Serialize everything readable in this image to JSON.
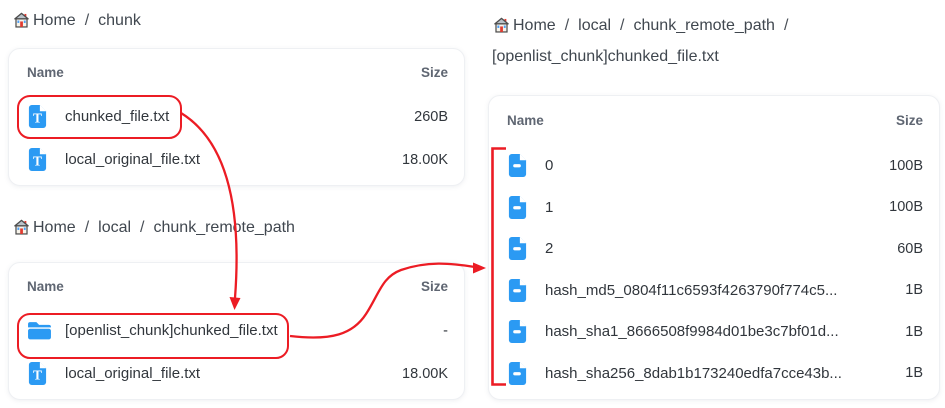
{
  "ui": {
    "breadcrumb_separator": "/"
  },
  "colors": {
    "annotation_red": "#ec1c24",
    "icon_blue": "#2b9af3"
  },
  "panels": [
    {
      "name": "chunk-folder-view",
      "breadcrumb": {
        "items": [
          "Home",
          "chunk"
        ]
      },
      "table": {
        "headers": [
          "Name",
          "Size"
        ],
        "rows": [
          {
            "name": "chunked_file.txt",
            "size": "260B",
            "icon": "text-file",
            "highlighted": true
          },
          {
            "name": "local_original_file.txt",
            "size": "18.00K",
            "icon": "text-file",
            "highlighted": false
          }
        ]
      }
    },
    {
      "name": "chunk-remote-path-view",
      "breadcrumb": {
        "items": [
          "Home",
          "local",
          "chunk_remote_path"
        ]
      },
      "table": {
        "headers": [
          "Name",
          "Size"
        ],
        "rows": [
          {
            "name": "[openlist_chunk]chunked_file.txt",
            "size": "-",
            "icon": "folder",
            "highlighted": true
          },
          {
            "name": "local_original_file.txt",
            "size": "18.00K",
            "icon": "text-file",
            "highlighted": false
          }
        ]
      }
    },
    {
      "name": "chunked-file-contents-view",
      "breadcrumb": {
        "items": [
          "Home",
          "local",
          "chunk_remote_path",
          "[openlist_chunk]chunked_file.txt"
        ]
      },
      "table": {
        "headers": [
          "Name",
          "Size"
        ],
        "rows": [
          {
            "name": "0",
            "size": "100B",
            "icon": "chunk-file"
          },
          {
            "name": "1",
            "size": "100B",
            "icon": "chunk-file"
          },
          {
            "name": "2",
            "size": "60B",
            "icon": "chunk-file"
          },
          {
            "name": "hash_md5_0804f11c6593f4263790f774c5...",
            "size": "1B",
            "icon": "chunk-file"
          },
          {
            "name": "hash_sha1_8666508f9984d01be3c7bf01d...",
            "size": "1B",
            "icon": "chunk-file"
          },
          {
            "name": "hash_sha256_8dab1b173240edfa7cce43b...",
            "size": "1B",
            "icon": "chunk-file"
          }
        ]
      }
    }
  ]
}
